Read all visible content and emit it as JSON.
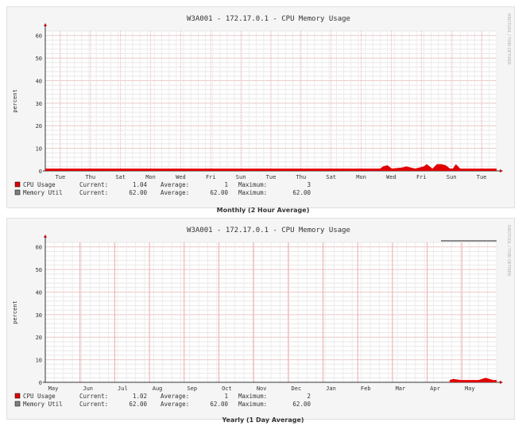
{
  "charts": [
    {
      "title": "W3A001 - 172.17.0.1 - CPU Memory Usage",
      "caption": "Monthly (2 Hour Average)",
      "ylabel": "percent",
      "watermark": "RRDTOOL / TOBI OETIKER",
      "legend": [
        {
          "name": "CPU Usage",
          "current_label": "Current:",
          "current": "1.04",
          "average_label": "Average:",
          "average": "1",
          "maximum_label": "Maximum:",
          "maximum": "3"
        },
        {
          "name": "Memory Util",
          "current_label": "Current:",
          "current": "62.00",
          "average_label": "Average:",
          "average": "62.00",
          "maximum_label": "Maximum:",
          "maximum": "62.00"
        }
      ]
    },
    {
      "title": "W3A001 - 172.17.0.1 - CPU Memory Usage",
      "caption": "Yearly (1 Day Average)",
      "ylabel": "percent",
      "watermark": "RRDTOOL / TOBI OETIKER",
      "legend": [
        {
          "name": "CPU Usage",
          "current_label": "Current:",
          "current": "1.02",
          "average_label": "Average:",
          "average": "1",
          "maximum_label": "Maximum:",
          "maximum": "2"
        },
        {
          "name": "Memory Util",
          "current_label": "Current:",
          "current": "62.00",
          "average_label": "Average:",
          "average": "62.00",
          "maximum_label": "Maximum:",
          "maximum": "62.00"
        }
      ]
    }
  ],
  "chart_data": [
    {
      "type": "area",
      "title": "W3A001 - 172.17.0.1 - CPU Memory Usage",
      "ylabel": "percent",
      "ylim": [
        0,
        62
      ],
      "yticks": [
        0,
        10,
        20,
        30,
        40,
        50,
        60
      ],
      "grid": true,
      "xticks": [
        "Tue",
        "Thu",
        "Sat",
        "Mon",
        "Wed",
        "Fri",
        "Sun",
        "Tue",
        "Thu",
        "Sat",
        "Mon",
        "Wed",
        "Fri",
        "Sun",
        "Tue"
      ],
      "x_range": [
        0,
        31
      ],
      "series": [
        {
          "name": "CPU Usage",
          "color": "#e00000",
          "x": [
            0,
            4,
            8,
            12,
            16,
            20,
            23,
            23.2,
            23.5,
            23.8,
            24.5,
            24.8,
            25.1,
            25.4,
            26.0,
            26.2,
            26.4,
            26.6,
            26.9,
            27.2,
            27.5,
            27.8,
            28,
            28.2,
            28.5,
            29,
            31
          ],
          "values": [
            1,
            1,
            1,
            1,
            1,
            1,
            1,
            2,
            2.5,
            1,
            1.5,
            2,
            1.5,
            1,
            2,
            3,
            2,
            1,
            3,
            3,
            2.5,
            1,
            1,
            3,
            1,
            1,
            1
          ]
        },
        {
          "name": "Memory Util",
          "color": "#808080",
          "x": [],
          "values": []
        }
      ]
    },
    {
      "type": "area",
      "title": "W3A001 - 172.17.0.1 - CPU Memory Usage",
      "ylabel": "percent",
      "ylim": [
        0,
        62
      ],
      "yticks": [
        0,
        10,
        20,
        30,
        40,
        50,
        60
      ],
      "grid": true,
      "xticks": [
        "May",
        "Jun",
        "Jul",
        "Aug",
        "Sep",
        "Oct",
        "Nov",
        "Dec",
        "Jan",
        "Feb",
        "Mar",
        "Apr",
        "May"
      ],
      "x_range": [
        0,
        12.5
      ],
      "series": [
        {
          "name": "CPU Usage",
          "color": "#e00000",
          "x": [
            11.2,
            11.3,
            11.5,
            11.8,
            12.0,
            12.1,
            12.2,
            12.3,
            12.4,
            12.5
          ],
          "values": [
            1,
            1.5,
            1,
            1,
            1,
            1.5,
            2,
            1.5,
            1,
            1
          ]
        },
        {
          "name": "Memory Util",
          "color": "#808080",
          "x": [],
          "values": []
        }
      ]
    }
  ]
}
